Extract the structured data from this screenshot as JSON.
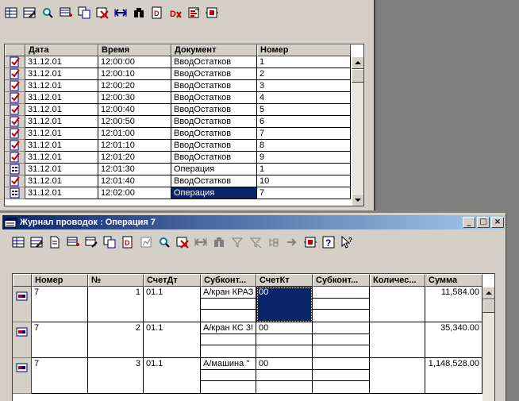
{
  "journal": {
    "toolbar": [
      {
        "name": "new-row-icon",
        "color": "#000080"
      },
      {
        "name": "edit-row-icon",
        "color": "#000080"
      },
      {
        "name": "find-icon",
        "color": "#008080"
      },
      {
        "name": "add-list-icon",
        "color": "#000080"
      },
      {
        "name": "copy-icon",
        "color": "#000080"
      },
      {
        "name": "delete-mark-icon",
        "color": "#c00000"
      },
      {
        "name": "interval-icon",
        "color": "#000080"
      },
      {
        "name": "binoculars-icon",
        "color": "#000000"
      },
      {
        "name": "post-document-icon",
        "color": "#c00000"
      },
      {
        "name": "unpost-document-icon",
        "color": "#c00000"
      },
      {
        "name": "transactions-icon",
        "color": "#c00000"
      },
      {
        "name": "structure-icon",
        "color": "#c00000"
      }
    ],
    "columns": [
      "Дата",
      "Время",
      "Документ",
      "Номер"
    ],
    "rows": [
      {
        "icon": "posted-doc-icon",
        "date": "31.12.01",
        "time": "12:00:00",
        "doc": "ВводОстатков",
        "num": "1"
      },
      {
        "icon": "posted-doc-icon",
        "date": "31.12.01",
        "time": "12:00:10",
        "doc": "ВводОстатков",
        "num": "2"
      },
      {
        "icon": "posted-doc-icon",
        "date": "31.12.01",
        "time": "12:00:20",
        "doc": "ВводОстатков",
        "num": "3"
      },
      {
        "icon": "posted-doc-icon",
        "date": "31.12.01",
        "time": "12:00:30",
        "doc": "ВводОстатков",
        "num": "4"
      },
      {
        "icon": "posted-doc-icon",
        "date": "31.12.01",
        "time": "12:00:40",
        "doc": "ВводОстатков",
        "num": "5"
      },
      {
        "icon": "posted-doc-icon",
        "date": "31.12.01",
        "time": "12:00:50",
        "doc": "ВводОстатков",
        "num": "6"
      },
      {
        "icon": "posted-doc-icon",
        "date": "31.12.01",
        "time": "12:01:00",
        "doc": "ВводОстатков",
        "num": "7"
      },
      {
        "icon": "posted-doc-icon",
        "date": "31.12.01",
        "time": "12:01:10",
        "doc": "ВводОстатков",
        "num": "8"
      },
      {
        "icon": "posted-doc-icon",
        "date": "31.12.01",
        "time": "12:01:20",
        "doc": "ВводОстатков",
        "num": "9"
      },
      {
        "icon": "operation-icon",
        "date": "31.12.01",
        "time": "12:01:30",
        "doc": "Операция",
        "num": "1"
      },
      {
        "icon": "posted-doc-icon",
        "date": "31.12.01",
        "time": "12:01:40",
        "doc": "ВводОстатков",
        "num": "10"
      },
      {
        "icon": "operation-icon",
        "date": "31.12.01",
        "time": "12:02:00",
        "doc": "Операция",
        "num": "7",
        "selected": true
      }
    ]
  },
  "entries": {
    "title": "Журнал проводок : Операция 7",
    "caption_buttons": {
      "minimize": "_",
      "maximize": "□",
      "close": "×"
    },
    "toolbar": [
      {
        "name": "new-row-icon",
        "color": "#000080"
      },
      {
        "name": "edit-row-icon",
        "color": "#000080"
      },
      {
        "name": "document-icon",
        "color": "#000000"
      },
      {
        "name": "add-list-icon",
        "color": "#000080"
      },
      {
        "name": "edit-list-icon",
        "color": "#000080"
      },
      {
        "name": "copy-icon",
        "color": "#000080"
      },
      {
        "name": "post-document-icon",
        "color": "#c00000"
      },
      {
        "name": "report-icon",
        "color": "#808080"
      },
      {
        "name": "find-icon",
        "color": "#008080"
      },
      {
        "name": "delete-mark-icon",
        "color": "#c00000"
      },
      {
        "name": "interval-icon",
        "color": "#808080"
      },
      {
        "name": "binoculars-icon",
        "color": "#808080"
      },
      {
        "name": "filter-icon",
        "color": "#808080"
      },
      {
        "name": "filter-off-icon",
        "color": "#808080"
      },
      {
        "name": "tree-icon",
        "color": "#808080"
      },
      {
        "name": "goto-icon",
        "color": "#808080"
      },
      {
        "name": "structure-icon",
        "color": "#c00000"
      },
      {
        "name": "help-icon",
        "color": "#000080"
      },
      {
        "name": "context-help-icon",
        "color": "#000000"
      }
    ],
    "columns": [
      "Номер",
      "№",
      "СчетДт",
      "Субконт...",
      "СчетКт",
      "Субконт...",
      "Количес...",
      "Сумма"
    ],
    "rows": [
      {
        "icon": "entry-icon",
        "num": "7",
        "n": "1",
        "debit": "01.1",
        "sub_dt": "А/кран КРАЗ",
        "credit": "00",
        "sub_kt": "",
        "qty": "",
        "sum": "11,584.00",
        "selected_credit": true
      },
      {
        "icon": "entry-icon",
        "num": "7",
        "n": "2",
        "debit": "01.1",
        "sub_dt": "А/кран КС 3!",
        "credit": "00",
        "sub_kt": "",
        "qty": "",
        "sum": "35,340.00"
      },
      {
        "icon": "entry-icon",
        "num": "7",
        "n": "3",
        "debit": "01.1",
        "sub_dt": "А/машина  ''",
        "credit": "00",
        "sub_kt": "",
        "qty": "",
        "sum": "1,148,528.00"
      }
    ]
  }
}
